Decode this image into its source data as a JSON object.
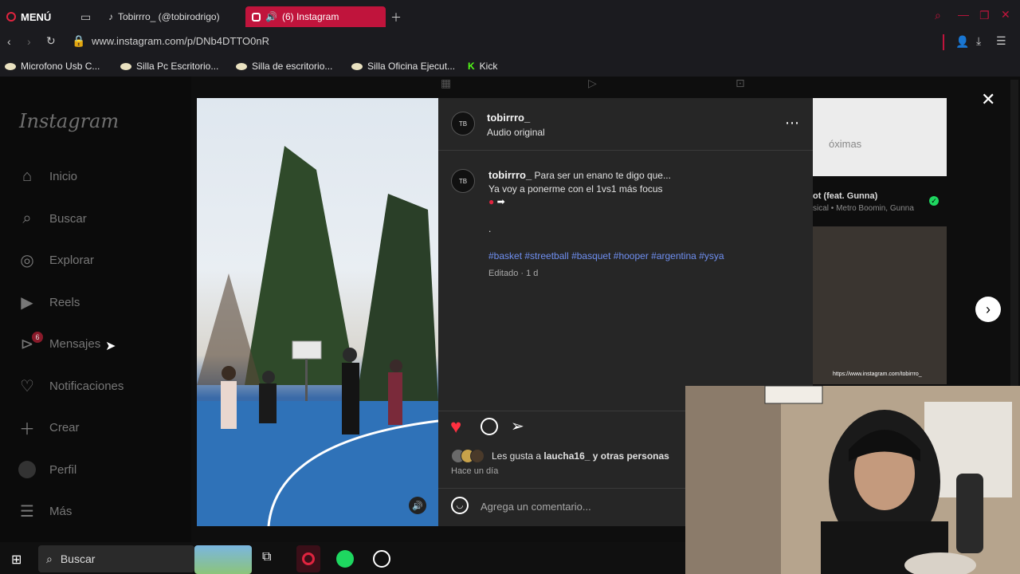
{
  "browser": {
    "menu_label": "MENÚ",
    "tabs": [
      {
        "label": "Tobirrro_ (@tobirodrigo)",
        "active": false
      },
      {
        "label": "(6) Instagram",
        "active": true
      }
    ],
    "url": "www.instagram.com/p/DNb4DTTO0nR",
    "bookmarks": [
      {
        "label": "Microfono Usb C..."
      },
      {
        "label": "Silla Pc Escritorio..."
      },
      {
        "label": "Silla de escritorio..."
      },
      {
        "label": "Silla Oficina Ejecut..."
      },
      {
        "label": "Kick"
      }
    ]
  },
  "sidebar": {
    "logo": "Instagram",
    "items": [
      {
        "label": "Inicio",
        "icon": "home-icon"
      },
      {
        "label": "Buscar",
        "icon": "search-icon"
      },
      {
        "label": "Explorar",
        "icon": "compass-icon"
      },
      {
        "label": "Reels",
        "icon": "reels-icon"
      },
      {
        "label": "Mensajes",
        "icon": "messenger-icon"
      },
      {
        "label": "Notificaciones",
        "icon": "heart-icon"
      },
      {
        "label": "Crear",
        "icon": "plus-icon"
      },
      {
        "label": "Perfil",
        "icon": "avatar-icon"
      },
      {
        "label": "Más",
        "icon": "menu-icon"
      }
    ],
    "messages_badge": "6"
  },
  "post": {
    "author": "tobirrro_",
    "audio": "Audio original",
    "caption_user": "tobirrro_",
    "caption_line1": "Para ser un enano te digo que...",
    "caption_line2": "Ya voy a ponerme con el 1vs1 más focus",
    "caption_dot": ".",
    "hashtags": "#basket #streetball #basquet #hooper #argentina #ysya",
    "edited": "Editado · 1 d",
    "likes_prefix": "Les gusta a",
    "likes_user": "laucha16_",
    "likes_suffix": "y otras personas",
    "time": "Hace un día",
    "comment_placeholder": "Agrega un comentario..."
  },
  "stream_overlay": {
    "card_text": "óximas",
    "song_title": "ot (feat. Gunna)",
    "song_sub": "sical • Metro Boomin, Gunna",
    "webcam_url": "https://www.instagram.com/tobirrro_"
  },
  "taskbar": {
    "search_label": "Buscar"
  },
  "colors": {
    "accent": "#c0143c",
    "like": "#ff3040",
    "hashtag": "#6f8ff0"
  }
}
